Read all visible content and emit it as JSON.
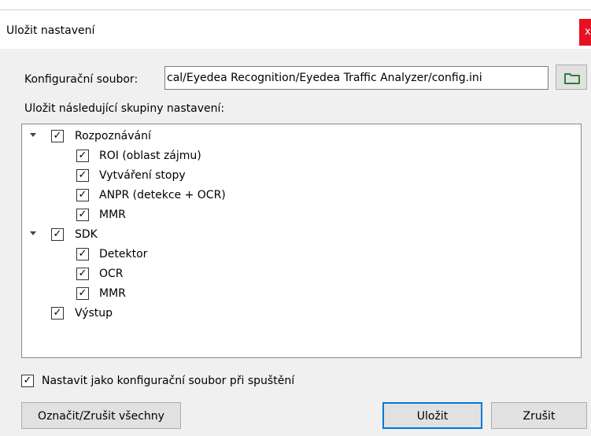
{
  "dialog": {
    "title": "Uložit nastavení",
    "close_glyph": "x"
  },
  "config": {
    "label": "Konfigurační soubor:",
    "path": "cal/Eyedea Recognition/Eyedea Traffic Analyzer/config.ini",
    "browse_icon": "folder-icon"
  },
  "groups_label": "Uložit následující skupiny nastavení:",
  "tree": {
    "rozpoznavani": {
      "label": "Rozpoznávání",
      "checked": true,
      "expanded": true,
      "children": [
        {
          "label": "ROI (oblast zájmu)",
          "checked": true
        },
        {
          "label": "Vytváření stopy",
          "checked": true
        },
        {
          "label": "ANPR (detekce + OCR)",
          "checked": true
        },
        {
          "label": "MMR",
          "checked": true
        }
      ]
    },
    "sdk": {
      "label": "SDK",
      "checked": true,
      "expanded": true,
      "children": [
        {
          "label": "Detektor",
          "checked": true
        },
        {
          "label": "OCR",
          "checked": true
        },
        {
          "label": "MMR",
          "checked": true
        }
      ]
    },
    "vystup": {
      "label": "Výstup",
      "checked": true
    }
  },
  "check_glyph": "✓",
  "startup": {
    "label": "Nastavit jako konfigurační soubor při spuštění",
    "checked": true
  },
  "buttons": {
    "toggle_all": "Označit/Zrušit všechny",
    "save": "Uložit",
    "cancel": "Zrušit"
  },
  "colors": {
    "close": "#e81123",
    "default_button_border": "#0078d7",
    "folder": "#2e7d32"
  }
}
